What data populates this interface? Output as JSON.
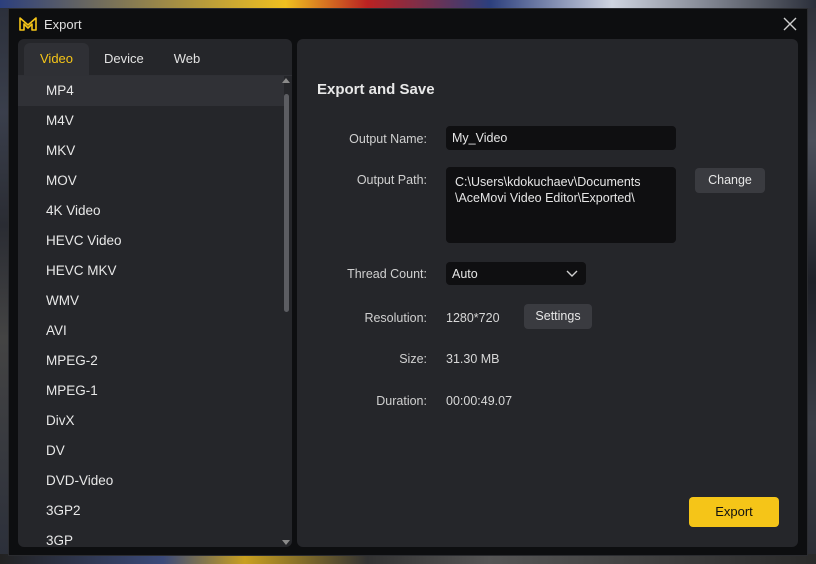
{
  "window": {
    "title": "Export"
  },
  "tabs": [
    {
      "label": "Video",
      "active": true
    },
    {
      "label": "Device",
      "active": false
    },
    {
      "label": "Web",
      "active": false
    }
  ],
  "formats": [
    "MP4",
    "M4V",
    "MKV",
    "MOV",
    "4K Video",
    "HEVC Video",
    "HEVC MKV",
    "WMV",
    "AVI",
    "MPEG-2",
    "MPEG-1",
    "DivX",
    "DV",
    "DVD-Video",
    "3GP2",
    "3GP"
  ],
  "selected_format": "MP4",
  "main": {
    "section_title": "Export and Save",
    "output_name": {
      "label": "Output Name:",
      "value": "My_Video"
    },
    "output_path": {
      "label": "Output Path:",
      "line1": "C:\\Users\\kdokuchaev\\Documents",
      "line2": "\\AceMovi Video Editor\\Exported\\",
      "change_label": "Change"
    },
    "thread_count": {
      "label": "Thread Count:",
      "value": "Auto"
    },
    "resolution": {
      "label": "Resolution:",
      "value": "1280*720",
      "settings_label": "Settings"
    },
    "size": {
      "label": "Size:",
      "value": "31.30 MB"
    },
    "duration": {
      "label": "Duration:",
      "value": "00:00:49.07"
    },
    "export_label": "Export"
  },
  "colors": {
    "accent": "#f5c518",
    "panel": "#25262a",
    "dialog": "#0d0e10"
  },
  "icons": {
    "logo": "acemovi-logo-icon",
    "close": "close-icon",
    "dropdown": "chevron-down-icon"
  }
}
